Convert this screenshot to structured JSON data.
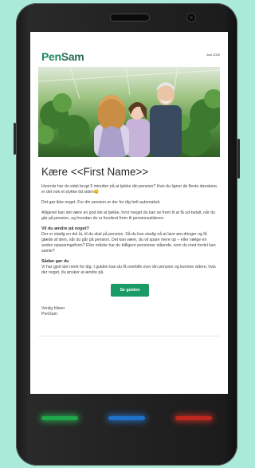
{
  "email": {
    "brand_part1": "Pen",
    "brand_part2": "Sam",
    "date": "Juni 2020",
    "greeting": "Kære <<First Name>>",
    "intro": "Hvornår har du sidst brugt 5 minutter på at tjekke din pension? Hvis du ligner de fleste danskere, er det nok et stykke tid siden",
    "emoji": "😊",
    "p2": "Det gør ikke noget. For din pension er der for dig helt automatisk.",
    "p3": "Alligevel kan det være en god ide at tjekke, hvor meget du kan se frem til at få ud-betalt, når du går på pension, og hvordan du er forsikret frem til pensionsalderen.",
    "section1_heading": "Vil du ændre på noget?",
    "section1_body": "Der er stadig en del år, til du skal på pension. Så du kan stadig nå at lave æn-dringer og få glæde af dem, når du går på pension. Det kan være, du vil spare mere op – eller vælge en anden opsparingsform? Eller måske har du tidligere pensioner stående, som du med fordel kan samle?",
    "section2_heading": "Sådan gør du",
    "section2_body": "Vi har gjort det nemt for dig. I guiden kan du få overblik over din pension og komme videre, hvis der noget, du ønsker at ændre på.",
    "cta_label": "Se guiden",
    "signoff_line1": "Venlig hilsen",
    "signoff_line2": "PenSam"
  },
  "colors": {
    "brand_green": "#1a9a64",
    "background": "#a9ead8",
    "phone_body": "#222222"
  },
  "icons": [
    "speaker-grille",
    "front-camera",
    "smiley-emoji"
  ],
  "hero_image_description_only": ""
}
